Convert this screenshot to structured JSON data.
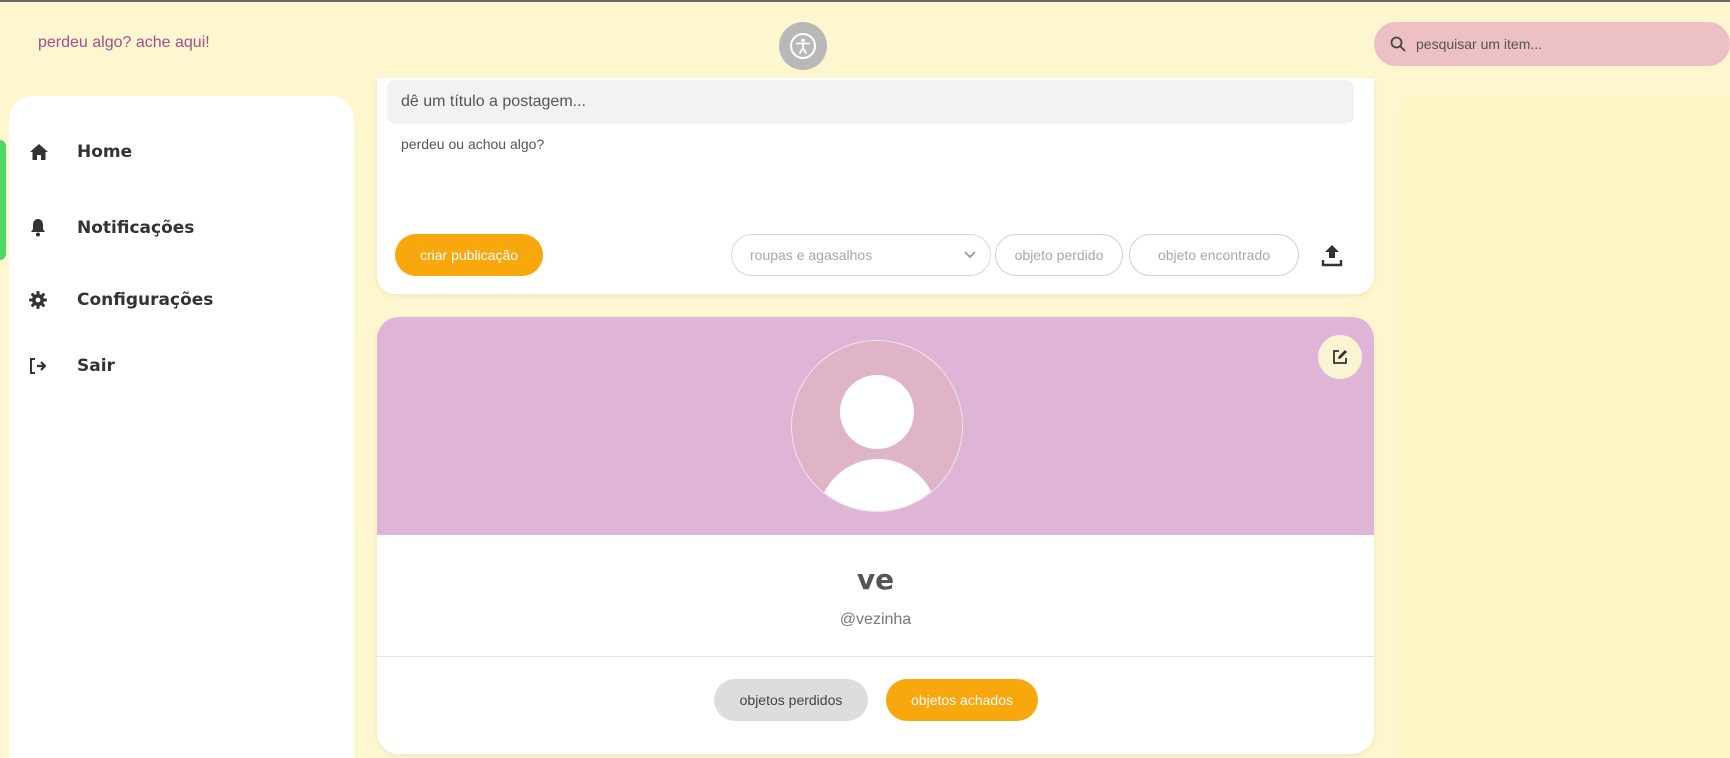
{
  "header": {
    "brand": "perdeu algo? ache aqui!",
    "accessibility_icon": "accessibility-icon",
    "search": {
      "placeholder": "pesquisar um item...",
      "icon": "search-icon"
    }
  },
  "sidebar": {
    "items": [
      {
        "label": "Home",
        "icon": "home-icon"
      },
      {
        "label": "Notificações",
        "icon": "bell-icon"
      },
      {
        "label": "Configurações",
        "icon": "gear-icon"
      },
      {
        "label": "Sair",
        "icon": "logout-icon"
      }
    ]
  },
  "composer": {
    "title_placeholder": "dê um título a postagem...",
    "body_placeholder": "perdeu ou achou algo?",
    "create_label": "criar publicação",
    "category_selected": "roupas e agasalhos",
    "lost_label": "objeto perdido",
    "found_label": "objeto encontrado"
  },
  "profile": {
    "name": "ve",
    "handle": "@vezinha",
    "tabs": {
      "lost": "objetos perdidos",
      "found": "objetos achados"
    }
  },
  "colors": {
    "background": "#fdf6cf",
    "accent_orange": "#f8a70d",
    "banner_pink": "#deb4d7",
    "search_pink": "#ecc0c4",
    "brand_text": "#a0508c"
  }
}
